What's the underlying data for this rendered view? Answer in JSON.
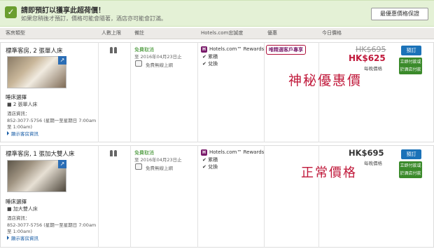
{
  "banner": {
    "title": "請即預訂以獲享此超荷價！",
    "subtitle": "如果您稍後才預訂，價格可能會隨著，酒店亦可能會訂滿。",
    "guarantee_button": "最優惠價格保證"
  },
  "columns": [
    "客房類型",
    "人數上限",
    "備註",
    "Hotels.com忠誠度",
    "優惠",
    "今日價格"
  ],
  "rooms": [
    {
      "name": "標準客房, 2 張單人床",
      "bed_choice_label": "睡床選擇",
      "bed_option": "2 張單人床",
      "hotel_info_label": "酒店資訊：",
      "phone": "852-3077-5756 (星期一至星期日 7:00am",
      "phone_cont": "至 1:00am)",
      "more_link": "顯示客房資訊",
      "cancel_title": "免費取消",
      "cancel_date": "至 2016年04月23日止",
      "wifi": "免費無線上網",
      "rewards": "Hotels.com™ Rewards",
      "collect": "累積",
      "redeem": "兌換",
      "promo": "唯精選客戶專享",
      "original_price": "HK$695",
      "price": "HK$625",
      "per_night": "每晚價格",
      "book": "預訂",
      "pay_now_line1": "立即付款或",
      "pay_now_line2": "於酒店付款",
      "annotation": "神秘優惠價"
    },
    {
      "name": "標準客房, 1 張加大雙人床",
      "bed_choice_label": "睡床選擇",
      "bed_option": "加大雙人床",
      "hotel_info_label": "酒店資訊：",
      "phone": "852-3077-5756 (星期一至星期日 7:00am",
      "phone_cont": "至 1:00am)",
      "more_link": "顯示客房資訊",
      "cancel_title": "免費取消",
      "cancel_date": "至 2016年04月23日止",
      "wifi": "免費無線上網",
      "rewards": "Hotels.com™ Rewards",
      "collect": "累積",
      "redeem": "兌換",
      "price": "HK$695",
      "per_night": "每晚價格",
      "book": "預訂",
      "pay_now_line1": "立即付款或",
      "pay_now_line2": "於酒店付款",
      "annotation": "正常價格"
    }
  ],
  "colors": {
    "banner_bg": "#e4f1d6",
    "book_blue": "#1b72b8",
    "pay_green": "#3a8a2a",
    "promo_red": "#c0183a",
    "rewards_purple": "#7a1c6b"
  }
}
